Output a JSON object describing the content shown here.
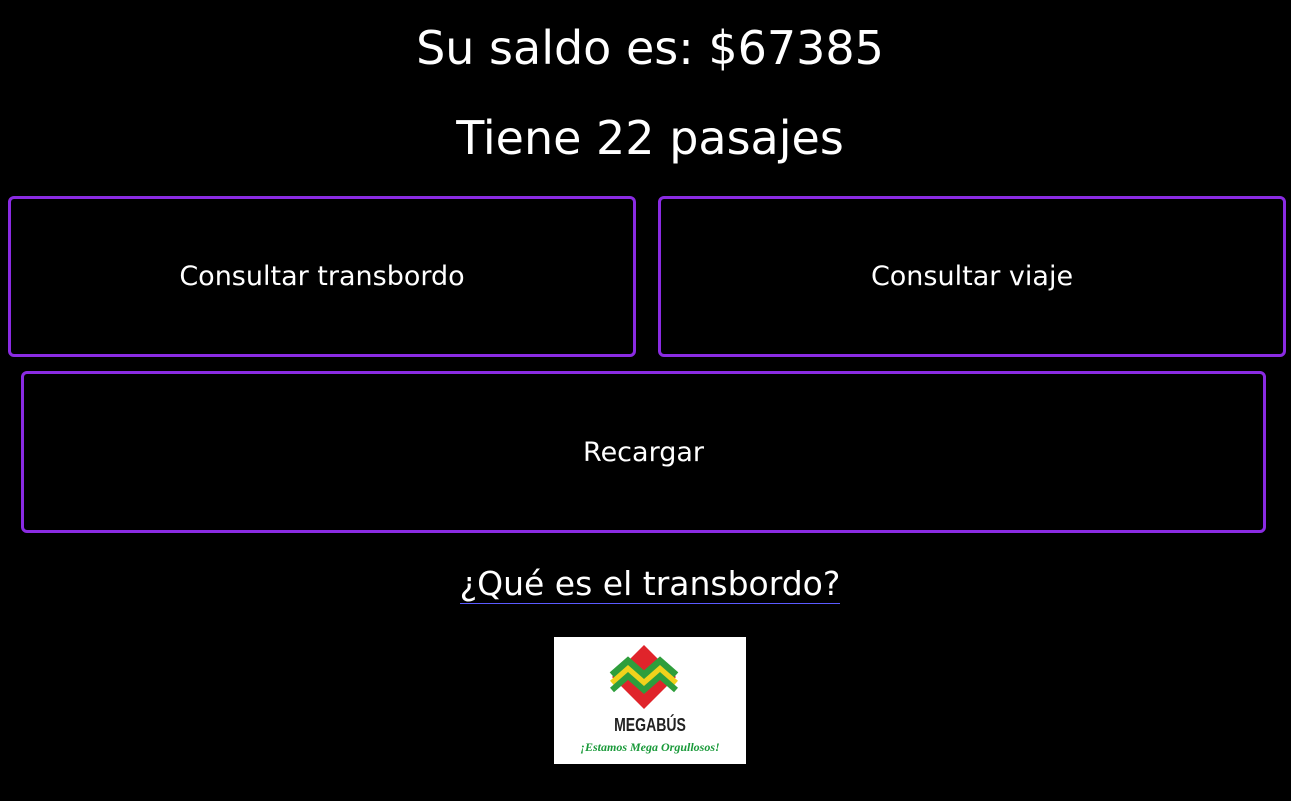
{
  "balance_text": "Su saldo es: $67385",
  "tickets_text": "Tiene 22 pasajes",
  "buttons": {
    "transfer": "Consultar transbordo",
    "trip": "Consultar viaje",
    "recharge": "Recargar"
  },
  "help_link": "¿Qué es el transbordo?",
  "logo": {
    "name": "MEGABÚS",
    "slogan": "¡Estamos Mega Orgullosos!"
  },
  "colors": {
    "background": "#000000",
    "text": "#ffffff",
    "button_border": "#8a2be2",
    "logo_red": "#e0242b",
    "logo_green": "#2e9e3c",
    "logo_yellow": "#f2d21c"
  }
}
